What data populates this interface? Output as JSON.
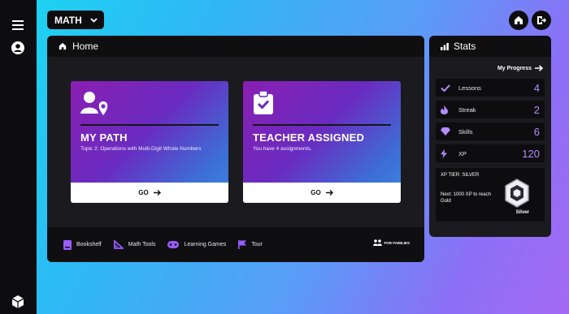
{
  "subject": {
    "label": "MATH"
  },
  "home_panel": {
    "title": "Home"
  },
  "cards": [
    {
      "title": "MY PATH",
      "subtitle": "Topic 2: Operations with Multi-Digit Whole Numbers",
      "button": "GO"
    },
    {
      "title": "TEACHER ASSIGNED",
      "subtitle": "You have 4 assignments.",
      "button": "GO"
    }
  ],
  "footer": {
    "items": [
      "Bookshelf",
      "Math Tools",
      "Learning Games",
      "Tour"
    ],
    "families": "FOR FAMILIES"
  },
  "stats": {
    "title": "Stats",
    "progress_link": "My Progress",
    "rows": [
      {
        "label": "Lessons",
        "value": "4",
        "icon": "check-icon"
      },
      {
        "label": "Streak",
        "value": "2",
        "icon": "flame-icon"
      },
      {
        "label": "Skills",
        "value": "6",
        "icon": "gem-icon"
      },
      {
        "label": "XP",
        "value": "120",
        "icon": "lightning-icon"
      }
    ],
    "tier": {
      "label": "XP TIER: SILVER",
      "next": "Next: 1000 XP to reach Gold",
      "name": "Silver"
    }
  },
  "colors": {
    "accent": "#b58cff",
    "panel": "#1b1b1f",
    "dark": "#0d0d0f"
  }
}
